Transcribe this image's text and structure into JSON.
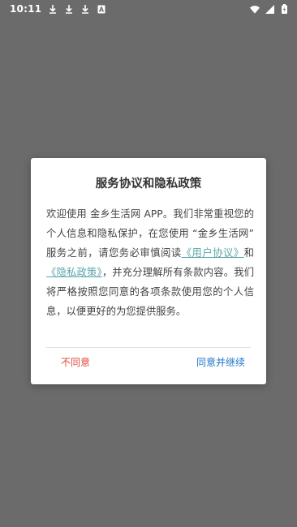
{
  "status_bar": {
    "time": "10:11",
    "icons": [
      "download-icon",
      "download-icon",
      "download-icon",
      "auto-icon"
    ],
    "right_icons": [
      "wifi-icon",
      "signal-icon",
      "battery-charging-icon"
    ],
    "a_glyph": "A"
  },
  "dialog": {
    "title": "服务协议和隐私政策",
    "body": {
      "part1": "欢迎使用 金乡生活网 APP。我们非常重视您的个人信息和隐私保护，在您使用 “金乡生活网” 服务之前，请您务必审慎阅读",
      "link_user": "《用户协议》",
      "conj": "和",
      "link_privacy": "《隐私政策》",
      "part2": "，并充分理解所有条款内容。我们将严格按照您同意的各项条款使用您的个人信息，以便更好的为您提供服务。"
    },
    "decline_label": "不同意",
    "accept_label": "同意并继续"
  },
  "colors": {
    "overlay": "#6b6b6b",
    "link": "#5aa5a8",
    "decline": "#e14a3c",
    "accept": "#2277c8"
  }
}
